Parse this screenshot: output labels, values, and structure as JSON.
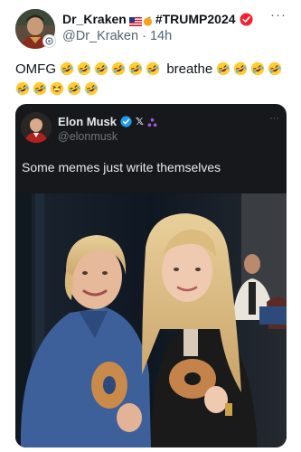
{
  "author": {
    "display_name": "Dr_Kraken",
    "hashtag": "#TRUMP2024",
    "handle": "@Dr_Kraken",
    "separator": "·",
    "time": "14h"
  },
  "icons": {
    "flag": "us-flag-icon",
    "orange": "orange-emoji-icon",
    "verified": "verified-badge-icon",
    "more": "more-options-icon",
    "laugh": "rolling-on-floor-laughing-emoji",
    "grin": "grinning-squinting-face-emoji",
    "x_logo": "x-logo-icon",
    "org": "affiliation-badge-icon"
  },
  "colors": {
    "verified_blue": "#1d9bf0",
    "verified_red": "#f4212e",
    "quote_bg": "#16181c",
    "muted": "#536471"
  },
  "tweet": {
    "text_start": "OMFG",
    "text_mid": "breathe",
    "more_label": "···"
  },
  "quoted": {
    "display_name": "Elon Musk",
    "x_label": "𝕏",
    "handle": "@elonmusk",
    "text": "Some memes just write themselves",
    "more_label": "···"
  }
}
